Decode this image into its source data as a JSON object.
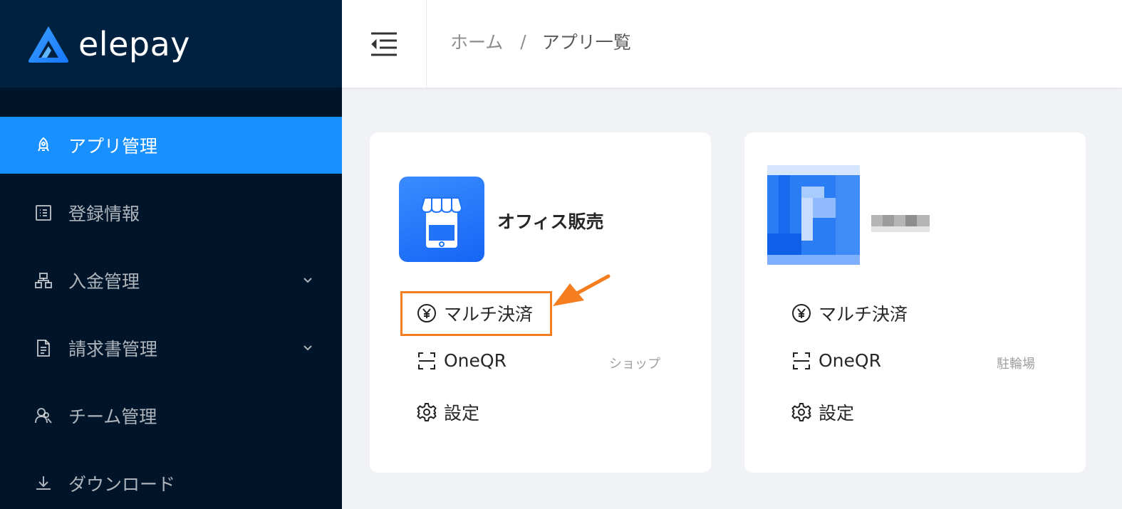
{
  "brand": {
    "name": "elepay",
    "colors": {
      "sidebar": "#001529",
      "logo_bar": "#002140",
      "active": "#1890ff",
      "annotation": "#f47e20",
      "app_icon": "#1565f5"
    }
  },
  "sidebar": {
    "items": [
      {
        "label": "アプリ管理",
        "icon": "rocket-icon",
        "active": true
      },
      {
        "label": "登録情報",
        "icon": "profile-icon"
      },
      {
        "label": "入金管理",
        "icon": "cluster-icon",
        "expandable": true
      },
      {
        "label": "請求書管理",
        "icon": "file-text-icon",
        "expandable": true
      },
      {
        "label": "チーム管理",
        "icon": "team-icon"
      },
      {
        "label": "ダウンロード",
        "icon": "download-icon"
      }
    ]
  },
  "header": {
    "fold_icon": "menu-fold-icon",
    "breadcrumb": {
      "home": "ホーム",
      "separator": "/",
      "current": "アプリ一覧"
    }
  },
  "cards": [
    {
      "name": "オフィス販売",
      "icon": "shop-icon",
      "actions": {
        "multi_payment": "マルチ決済",
        "oneqr": "OneQR",
        "oneqr_tag": "ショップ",
        "settings": "設定"
      },
      "highlighted_action": "multi_payment"
    },
    {
      "name": "",
      "icon": "pixelated-app-icon",
      "actions": {
        "multi_payment": "マルチ決済",
        "oneqr": "OneQR",
        "oneqr_tag": "駐輪場",
        "settings": "設定"
      }
    }
  ]
}
